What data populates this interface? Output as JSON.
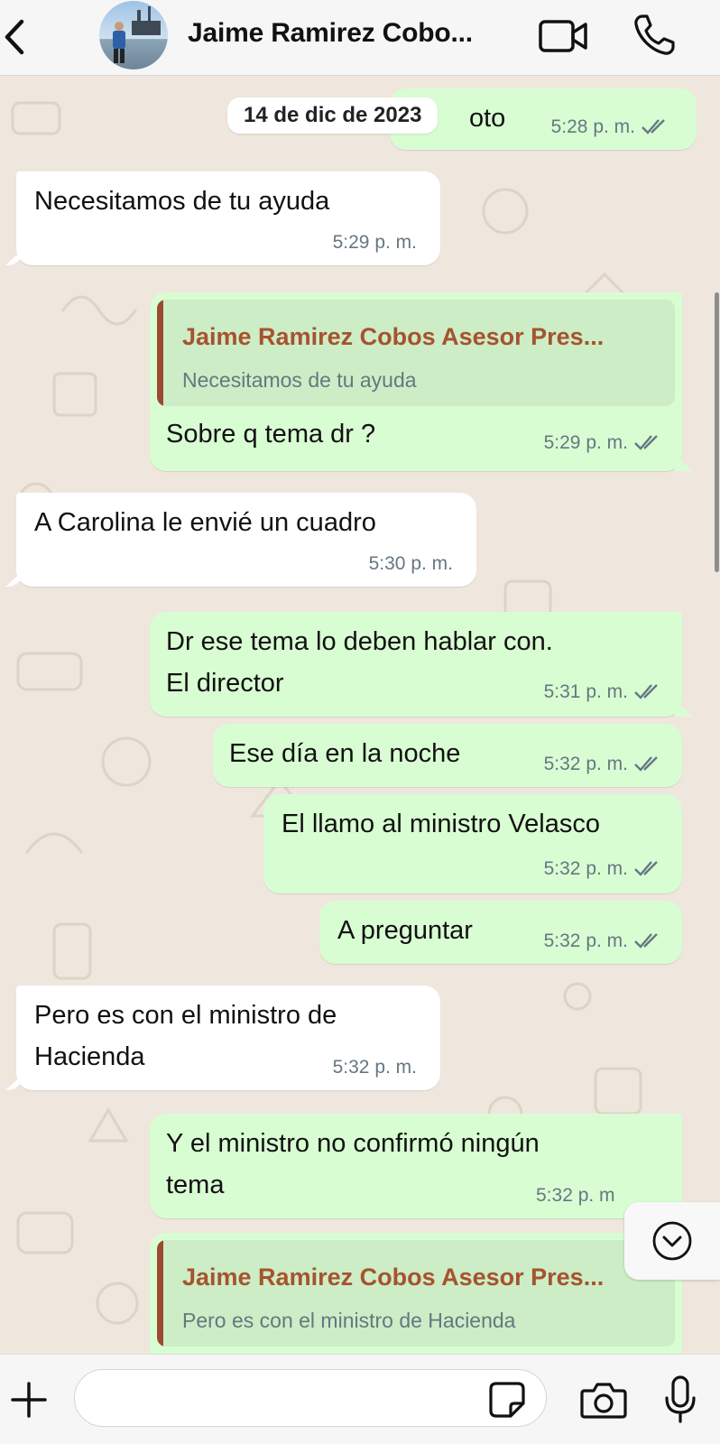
{
  "header": {
    "contact_name": "Jaime Ramirez Cobo...",
    "back_icon": "chevron-left-icon",
    "video_icon": "video-camera-icon",
    "call_icon": "phone-icon"
  },
  "chat": {
    "date_label": "14 de dic de 2023",
    "messages": [
      {
        "direction": "out",
        "text": "oto",
        "time": "5:28 p. m.",
        "read": true
      },
      {
        "direction": "in",
        "text": "Necesitamos de tu ayuda",
        "time": "5:29 p. m."
      },
      {
        "direction": "out",
        "reply_to": {
          "author": "Jaime Ramirez Cobos Asesor Pres...",
          "text": "Necesitamos de tu ayuda"
        },
        "text": "Sobre q tema dr ?",
        "time": "5:29 p. m.",
        "read": true
      },
      {
        "direction": "in",
        "text": "A Carolina le envié un cuadro",
        "time": "5:30 p. m."
      },
      {
        "direction": "out",
        "lines": [
          "Dr ese tema lo deben hablar con.",
          "El director"
        ],
        "time": "5:31 p. m.",
        "read": true
      },
      {
        "direction": "out",
        "text": "Ese día en la noche",
        "time": "5:32 p. m.",
        "read": true
      },
      {
        "direction": "out",
        "text": "El llamo al ministro Velasco",
        "time": "5:32 p. m.",
        "read": true
      },
      {
        "direction": "out",
        "text": "A preguntar",
        "time": "5:32 p. m.",
        "read": true
      },
      {
        "direction": "in",
        "lines": [
          "Pero es con el ministro de",
          "Hacienda"
        ],
        "time": "5:32 p. m."
      },
      {
        "direction": "out",
        "lines": [
          "Y el ministro no confirmó ningún",
          "tema"
        ],
        "time": "5:32 p. m"
      },
      {
        "direction": "out",
        "reply_to": {
          "author": "Jaime Ramirez Cobos Asesor Pres...",
          "text": "Pero es con el ministro de Hacienda"
        }
      }
    ]
  },
  "composer": {
    "placeholder": "",
    "plus_icon": "plus-icon",
    "sticker_icon": "sticker-icon",
    "camera_icon": "camera-icon",
    "mic_icon": "microphone-icon"
  },
  "colors": {
    "outgoing_bubble": "#d9fdd3",
    "incoming_bubble": "#ffffff",
    "quote_author": "#a6532e",
    "chat_background": "#efe7dd",
    "read_ticks": "#667781"
  },
  "scroll_down_icon": "chevron-down-circle-icon"
}
